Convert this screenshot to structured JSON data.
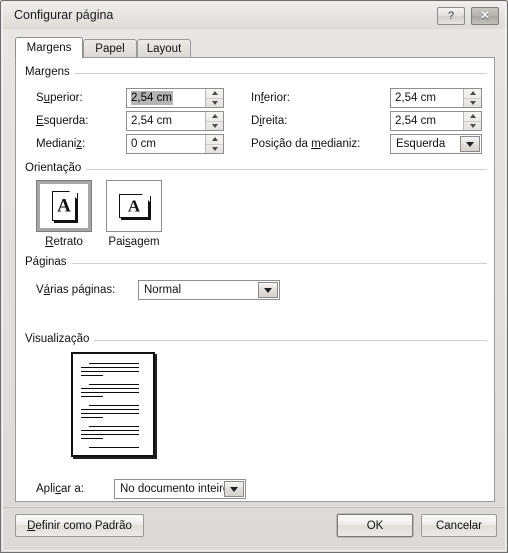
{
  "window": {
    "title": "Configurar página",
    "help_button": "?",
    "close_button": "✕"
  },
  "tabs": [
    {
      "label": "Margens",
      "active": true
    },
    {
      "label": "Papel",
      "active": false
    },
    {
      "label": "Layout",
      "active": false
    }
  ],
  "groups": {
    "margins": {
      "label": "Margens"
    },
    "orientation": {
      "label": "Orientação"
    },
    "pages": {
      "label": "Páginas"
    },
    "preview": {
      "label": "Visualização"
    }
  },
  "margins": {
    "top": {
      "label": "Superior:",
      "value": "2,54 cm",
      "selected": true
    },
    "bottom": {
      "label": "Inferior:",
      "value": "2,54 cm",
      "selected": false
    },
    "left": {
      "label": "Esquerda:",
      "value": "2,54 cm",
      "selected": false
    },
    "right": {
      "label": "Direita:",
      "value": "2,54 cm",
      "selected": false
    },
    "gutter": {
      "label": "Medianiz:",
      "value": "0 cm",
      "selected": false
    },
    "gutter_position": {
      "label": "Posição da medianiz:",
      "value": "Esquerda"
    }
  },
  "orientation": {
    "portrait": {
      "label": "Retrato",
      "glyph": "A",
      "selected": true
    },
    "landscape": {
      "label": "Paisagem",
      "glyph": "A",
      "selected": false
    }
  },
  "pages": {
    "multiple": {
      "label": "Várias páginas:",
      "value": "Normal"
    }
  },
  "apply": {
    "label": "Aplicar a:",
    "value": "No documento inteiro"
  },
  "footer": {
    "set_default": "Definir como Padrão",
    "ok": "OK",
    "cancel": "Cancelar"
  },
  "colors": {
    "dialog_bg": "#e4e2de",
    "panel_bg": "#ffffff",
    "selection": "#b4b4b4",
    "border": "#8f8f8f",
    "text": "#111111"
  }
}
